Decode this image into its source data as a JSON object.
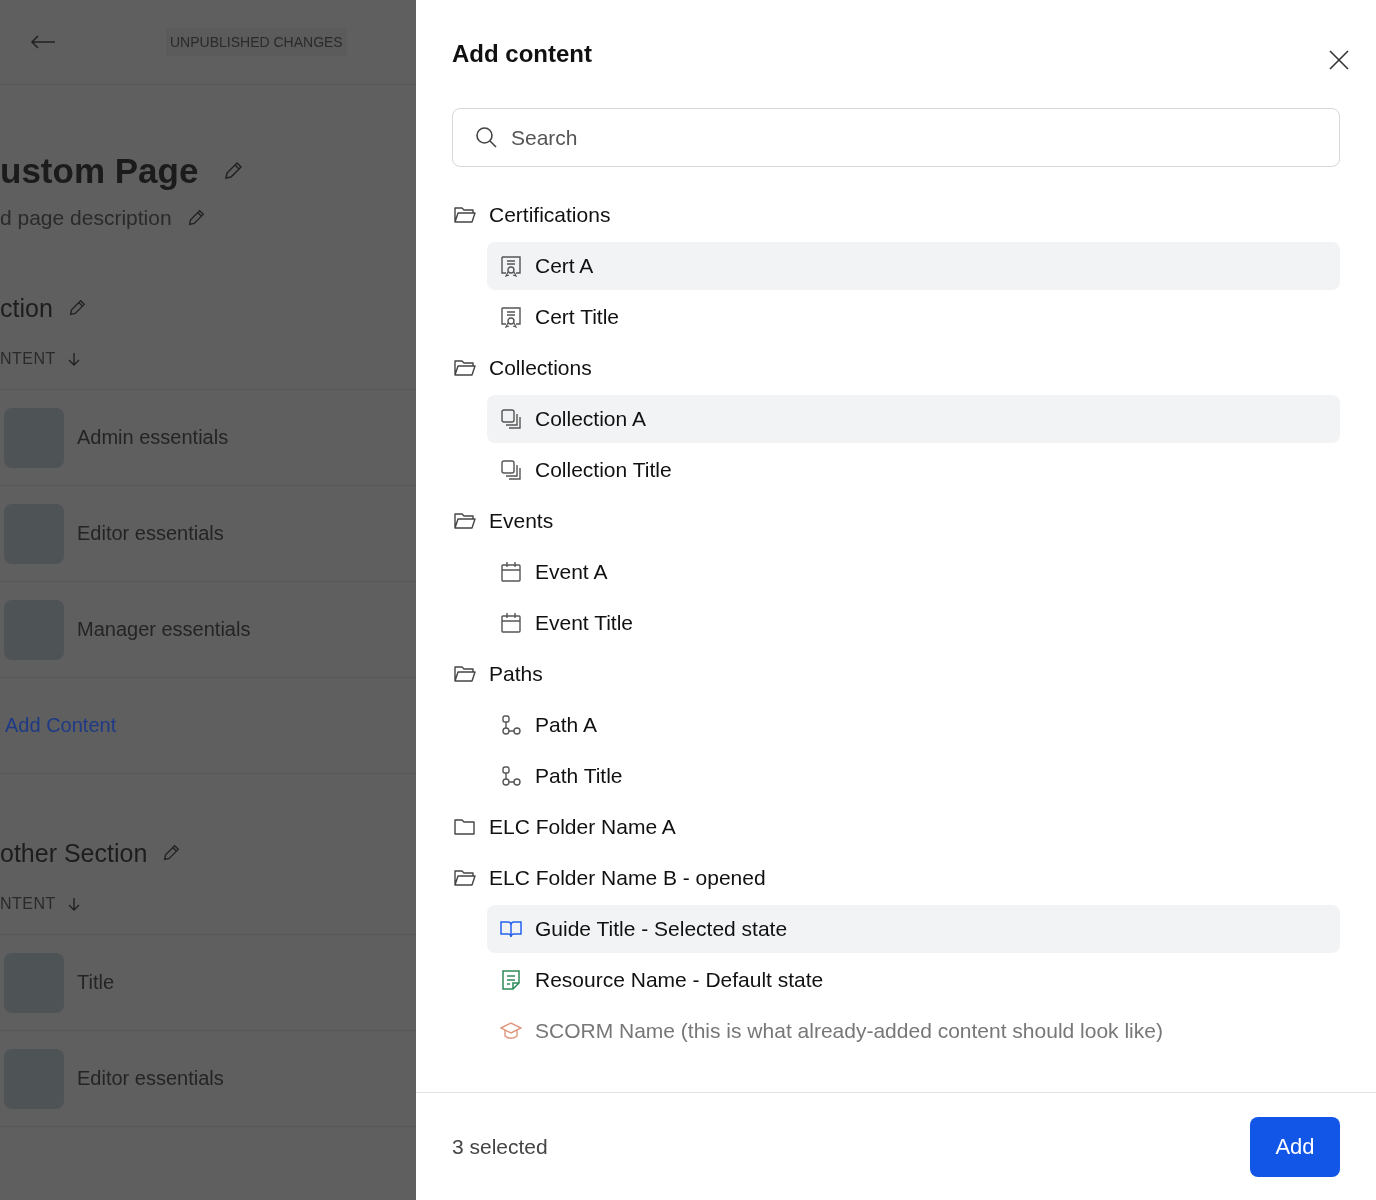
{
  "page": {
    "status_badge": "UNPUBLISHED CHANGES",
    "title": "ustom Page",
    "description": "d page description",
    "sections": [
      {
        "title": "ction",
        "column_header": "NTENT",
        "items": [
          "Admin essentials",
          "Editor essentials",
          "Manager essentials"
        ],
        "add_link": "Add Content"
      },
      {
        "title": "other Section",
        "column_header": "NTENT",
        "items": [
          "Title",
          "Editor essentials"
        ]
      }
    ]
  },
  "panel": {
    "title": "Add content",
    "search": {
      "placeholder": "Search"
    },
    "folders": [
      {
        "name": "Certifications",
        "expanded": true,
        "children": [
          {
            "name": "Cert A",
            "kind": "certificate",
            "selected": true,
            "disabled": false
          },
          {
            "name": "Cert Title",
            "kind": "certificate",
            "selected": false,
            "disabled": false
          }
        ]
      },
      {
        "name": "Collections",
        "expanded": true,
        "children": [
          {
            "name": "Collection A",
            "kind": "collection",
            "selected": true,
            "disabled": false
          },
          {
            "name": "Collection Title",
            "kind": "collection",
            "selected": false,
            "disabled": false
          }
        ]
      },
      {
        "name": "Events",
        "expanded": true,
        "children": [
          {
            "name": "Event A",
            "kind": "event",
            "selected": false,
            "disabled": false
          },
          {
            "name": "Event Title",
            "kind": "event",
            "selected": false,
            "disabled": false
          }
        ]
      },
      {
        "name": "Paths",
        "expanded": true,
        "children": [
          {
            "name": "Path A",
            "kind": "path",
            "selected": false,
            "disabled": false
          },
          {
            "name": "Path Title",
            "kind": "path",
            "selected": false,
            "disabled": false
          }
        ]
      },
      {
        "name": "ELC Folder Name A",
        "expanded": false
      },
      {
        "name": "ELC Folder Name B - opened",
        "expanded": true,
        "children": [
          {
            "name": "Guide Title - Selected state",
            "kind": "guide",
            "selected": true,
            "disabled": false
          },
          {
            "name": "Resource Name - Default state",
            "kind": "resource",
            "selected": false,
            "disabled": false
          },
          {
            "name": "SCORM Name (this is what already-added content should look like)",
            "kind": "scorm",
            "selected": false,
            "disabled": true
          }
        ]
      }
    ],
    "footer": {
      "selected_count": "3 selected",
      "add_button": "Add"
    }
  }
}
